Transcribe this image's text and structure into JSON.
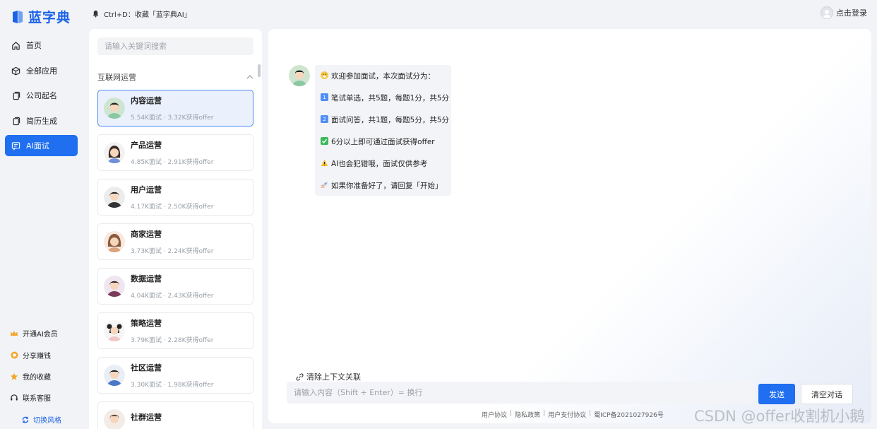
{
  "app": {
    "logo_text": "蓝字典",
    "brand_color": "#1d63e8",
    "accent_color": "#1f6ff0"
  },
  "topbar": {
    "notice": "Ctrl+D：收藏「蓝字典AI」",
    "notice_icon": "bell-icon",
    "login_label": "点击登录"
  },
  "sidebar": {
    "items": [
      {
        "label": "首页",
        "icon": "home-icon"
      },
      {
        "label": "全部应用",
        "icon": "cube-icon"
      },
      {
        "label": "公司起名",
        "icon": "copy-icon"
      },
      {
        "label": "简历生成",
        "icon": "copy-icon"
      },
      {
        "label": "AI面试",
        "icon": "chat-icon",
        "active": true
      }
    ],
    "bottom_items": [
      {
        "label": "开通AI会员",
        "icon": "crown-icon"
      },
      {
        "label": "分享赚钱",
        "icon": "coin-icon"
      },
      {
        "label": "我的收藏",
        "icon": "star-icon"
      },
      {
        "label": "联系客服",
        "icon": "headset-icon"
      }
    ],
    "switch_style": "切换风格"
  },
  "list": {
    "search_placeholder": "请输入关键词搜索",
    "category": "互联网运营",
    "cards": [
      {
        "title": "内容运营",
        "stats": "5.54K面试 · 3.32K获得offer",
        "active": true
      },
      {
        "title": "产品运营",
        "stats": "4.85K面试 · 2.91K获得offer"
      },
      {
        "title": "用户运营",
        "stats": "4.17K面试 · 2.50K获得offer"
      },
      {
        "title": "商家运营",
        "stats": "3.73K面试 · 2.24K获得offer"
      },
      {
        "title": "数据运营",
        "stats": "4.04K面试 · 2.43K获得offer"
      },
      {
        "title": "策略运营",
        "stats": "3.79K面试 · 2.28K获得offer"
      },
      {
        "title": "社区运营",
        "stats": "3.30K面试 · 1.98K获得offer"
      },
      {
        "title": "社群运营",
        "stats": ""
      }
    ]
  },
  "chat": {
    "messages": [
      {
        "icon": "grin-emoji",
        "text": "欢迎参加面试，本次面试分为："
      },
      {
        "icon": "keycap-1-emoji",
        "text": "笔试单选，共5题，每题1分，共5分"
      },
      {
        "icon": "keycap-2-emoji",
        "text": "面试问答，共1题，每题5分，共5分"
      },
      {
        "icon": "check-emoji",
        "text": "6分以上即可通过面试获得offer"
      },
      {
        "icon": "warning-emoji",
        "text": "AI也会犯错哦，面试仅供参考"
      },
      {
        "icon": "rocket-emoji",
        "text": "如果你准备好了，请回复「开始」"
      }
    ],
    "clear_context": "清除上下文关联",
    "input_placeholder": "请输入内容（Shift + Enter）= 换行",
    "send_label": "发送",
    "clear_label": "清空对话"
  },
  "footer": {
    "links": [
      "用户协议",
      "隐私政策",
      "用户支付协议"
    ],
    "icp": "蜀ICP备2021027926号"
  },
  "watermark": "CSDN @offer收割机小鹅"
}
